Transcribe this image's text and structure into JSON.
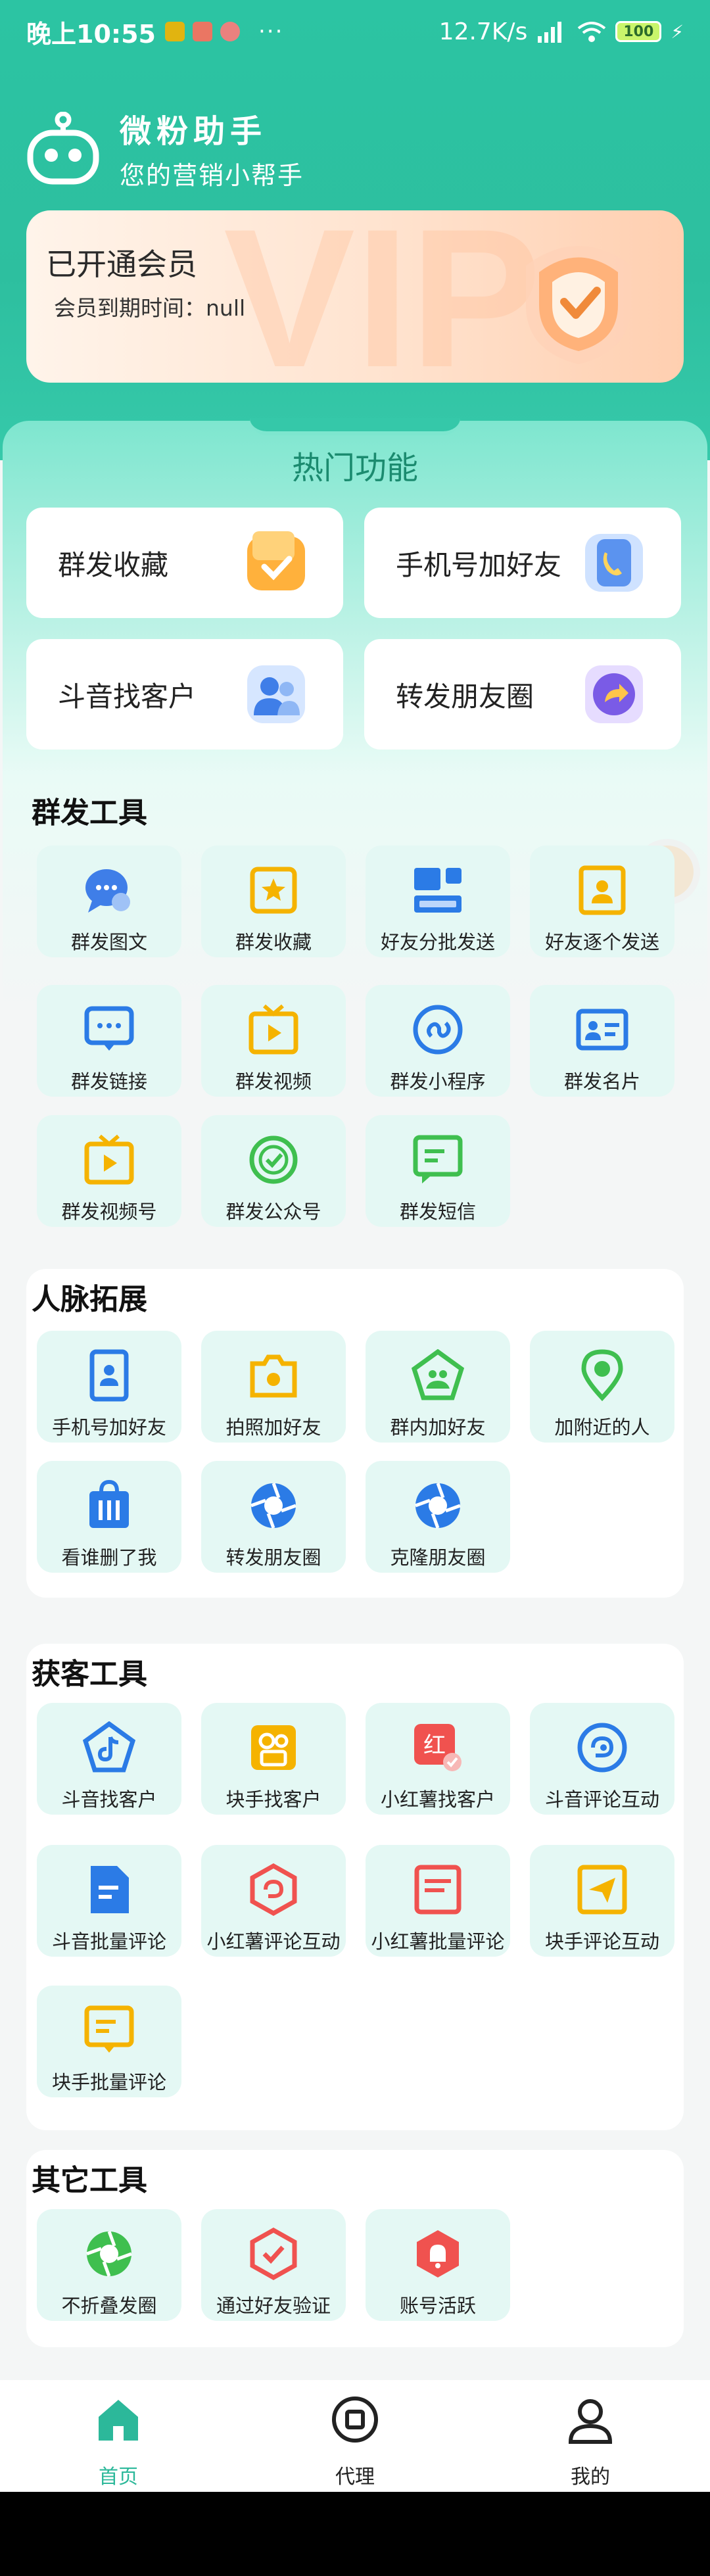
{
  "status_bar": {
    "time": "晚上10:55",
    "dots": "···",
    "speed": "12.7K/s",
    "battery": "100"
  },
  "brand": {
    "title": "微粉助手",
    "subtitle": "您的营销小帮手"
  },
  "vip": {
    "title": "已开通会员",
    "expire": "会员到期时间：null"
  },
  "hot": {
    "title": "热门功能",
    "items": [
      {
        "label": "群发收藏",
        "icon": "star-folder-icon"
      },
      {
        "label": "手机号加好友",
        "icon": "phonebook-icon"
      },
      {
        "label": "斗音找客户",
        "icon": "users-icon"
      },
      {
        "label": "转发朋友圈",
        "icon": "share-arrow-icon"
      }
    ]
  },
  "sections": {
    "broadcast": {
      "title": "群发工具",
      "items": [
        "群发图文",
        "群发收藏",
        "好友分批发送",
        "好友逐个发送",
        "群发链接",
        "群发视频",
        "群发小程序",
        "群发名片",
        "群发视频号",
        "群发公众号",
        "群发短信"
      ]
    },
    "network": {
      "title": "人脉拓展",
      "items": [
        "手机号加好友",
        "拍照加好友",
        "群内加好友",
        "加附近的人",
        "看谁删了我",
        "转发朋友圈",
        "克隆朋友圈"
      ]
    },
    "acquire": {
      "title": "获客工具",
      "items": [
        "斗音找客户",
        "块手找客户",
        "小红薯找客户",
        "斗音评论互动",
        "斗音批量评论",
        "小红薯评论互动",
        "小红薯批量评论",
        "块手评论互动",
        "块手批量评论"
      ]
    },
    "other": {
      "title": "其它工具",
      "items": [
        "不折叠发圈",
        "通过好友验证",
        "账号活跃"
      ]
    }
  },
  "tabs": [
    {
      "label": "首页",
      "icon": "home-icon",
      "active": true
    },
    {
      "label": "代理",
      "icon": "agent-icon",
      "active": false
    },
    {
      "label": "我的",
      "icon": "profile-icon",
      "active": false
    }
  ],
  "colors": {
    "accent": "#2cc4a3",
    "tab_active": "#2cb89a",
    "tile_bg": "#e4f8f4"
  }
}
